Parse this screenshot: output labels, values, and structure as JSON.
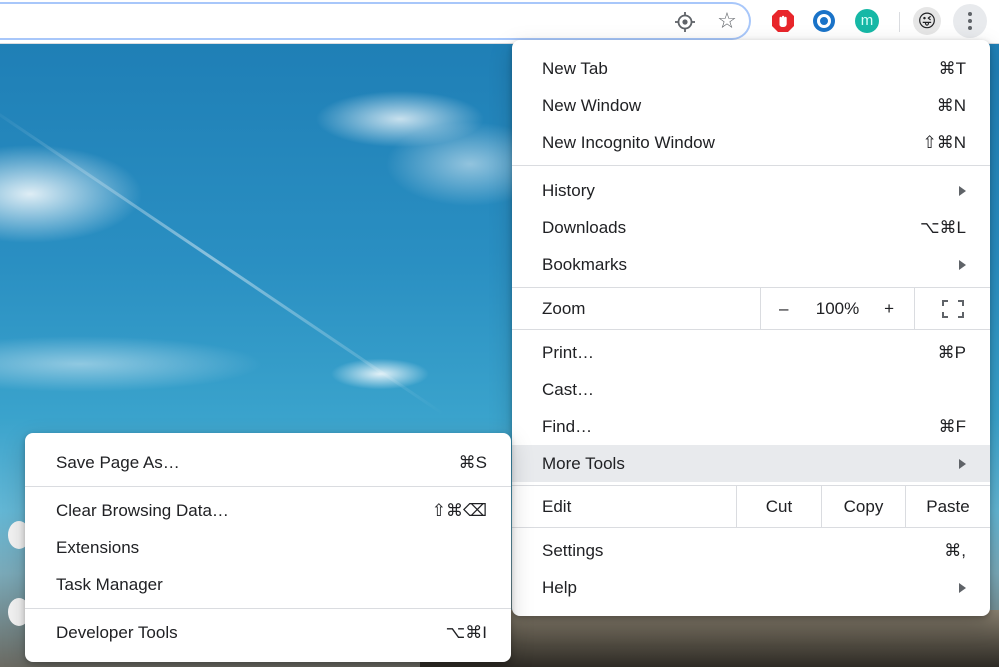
{
  "toolbar": {
    "extension_m_letter": "m",
    "avatar_emoji": "😜",
    "menu_button_icon": "kebab-menu-icon"
  },
  "main_menu": {
    "group1": [
      {
        "label": "New Tab",
        "shortcut": "⌘T"
      },
      {
        "label": "New Window",
        "shortcut": "⌘N"
      },
      {
        "label": "New Incognito Window",
        "shortcut": "⇧⌘N"
      }
    ],
    "group2": [
      {
        "label": "History",
        "has_submenu": true
      },
      {
        "label": "Downloads",
        "shortcut": "⌥⌘L"
      },
      {
        "label": "Bookmarks",
        "has_submenu": true
      }
    ],
    "zoom": {
      "label": "Zoom",
      "minus": "–",
      "value": "100%",
      "plus": "+",
      "fullscreen_icon": "fullscreen-icon"
    },
    "group3": [
      {
        "label": "Print…",
        "shortcut": "⌘P"
      },
      {
        "label": "Cast…",
        "shortcut": ""
      },
      {
        "label": "Find…",
        "shortcut": "⌘F"
      },
      {
        "label": "More Tools",
        "has_submenu": true,
        "highlighted": true
      }
    ],
    "edit": {
      "label": "Edit",
      "cut": "Cut",
      "copy": "Copy",
      "paste": "Paste"
    },
    "group4": [
      {
        "label": "Settings",
        "shortcut": "⌘,"
      },
      {
        "label": "Help",
        "has_submenu": true
      }
    ]
  },
  "more_tools_menu": {
    "items": [
      {
        "label": "Save Page As…",
        "shortcut": "⌘S"
      },
      {
        "label": "Clear Browsing Data…",
        "shortcut": "⇧⌘⌫"
      },
      {
        "label": "Extensions",
        "shortcut": ""
      },
      {
        "label": "Task Manager",
        "shortcut": ""
      },
      {
        "label": "Developer Tools",
        "shortcut": "⌥⌘I"
      }
    ]
  },
  "colors": {
    "highlight": "#e8eaed",
    "separator": "#dadce0",
    "omnibox_focus": "#a8c7fa",
    "stop_extension": "#e8262b",
    "circle_extension": "#1a73c8",
    "m_extension": "#16b8a6"
  }
}
